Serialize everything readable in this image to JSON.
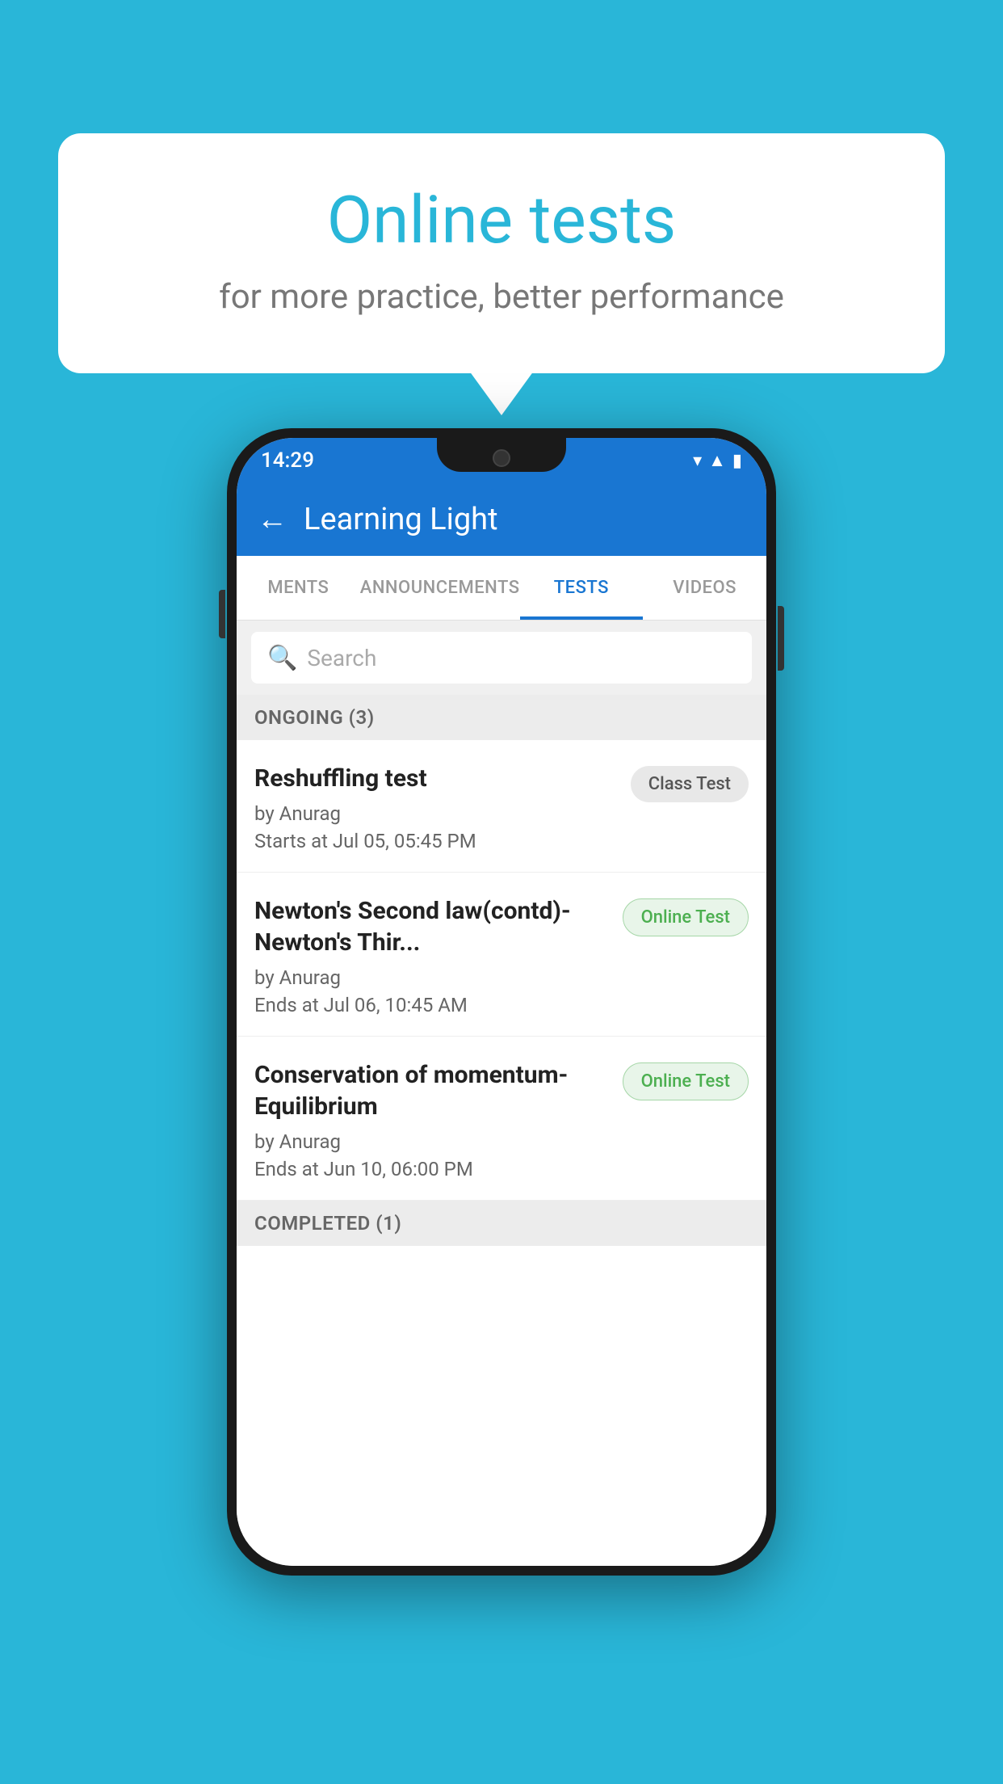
{
  "background": {
    "color": "#29b6d8"
  },
  "speechBubble": {
    "title": "Online tests",
    "subtitle": "for more practice, better performance"
  },
  "phone": {
    "statusBar": {
      "time": "14:29",
      "icons": [
        "wifi",
        "signal",
        "battery"
      ]
    },
    "appBar": {
      "title": "Learning Light",
      "backLabel": "←"
    },
    "tabs": [
      {
        "label": "MENTS",
        "active": false
      },
      {
        "label": "ANNOUNCEMENTS",
        "active": false
      },
      {
        "label": "TESTS",
        "active": true
      },
      {
        "label": "VIDEOS",
        "active": false
      }
    ],
    "search": {
      "placeholder": "Search",
      "icon": "🔍"
    },
    "sections": [
      {
        "header": "ONGOING (3)",
        "items": [
          {
            "name": "Reshuffling test",
            "by": "by Anurag",
            "time": "Starts at  Jul 05, 05:45 PM",
            "badge": "Class Test",
            "badgeType": "class"
          },
          {
            "name": "Newton's Second law(contd)-Newton's Thir...",
            "by": "by Anurag",
            "time": "Ends at  Jul 06, 10:45 AM",
            "badge": "Online Test",
            "badgeType": "online"
          },
          {
            "name": "Conservation of momentum-Equilibrium",
            "by": "by Anurag",
            "time": "Ends at  Jun 10, 06:00 PM",
            "badge": "Online Test",
            "badgeType": "online"
          }
        ]
      }
    ],
    "completedHeader": "COMPLETED (1)"
  }
}
